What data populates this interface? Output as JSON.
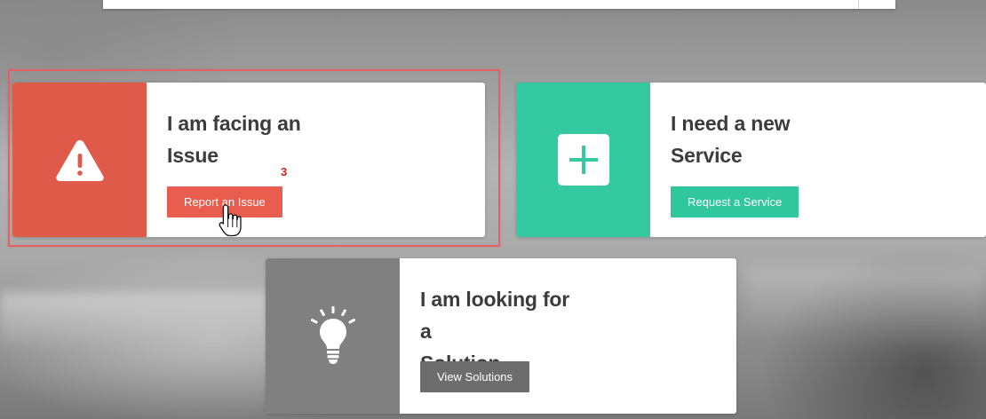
{
  "cards": {
    "issue": {
      "title_line1": "I am facing an",
      "title_line2": "Issue",
      "button_label": "Report an Issue",
      "icon": "warning-icon",
      "color": "#e05a4a"
    },
    "service": {
      "title_line1": "I need a new",
      "title_line2": "Service",
      "button_label": "Request a Service",
      "icon": "plus-icon",
      "color": "#34c99f"
    },
    "solution": {
      "title_line1": "I am looking for a",
      "title_line2": "Solution",
      "button_label": "View Solutions",
      "icon": "lightbulb-icon",
      "color": "#808080"
    }
  },
  "annotation": {
    "step_number": "3",
    "highlight_color": "#e06262"
  }
}
